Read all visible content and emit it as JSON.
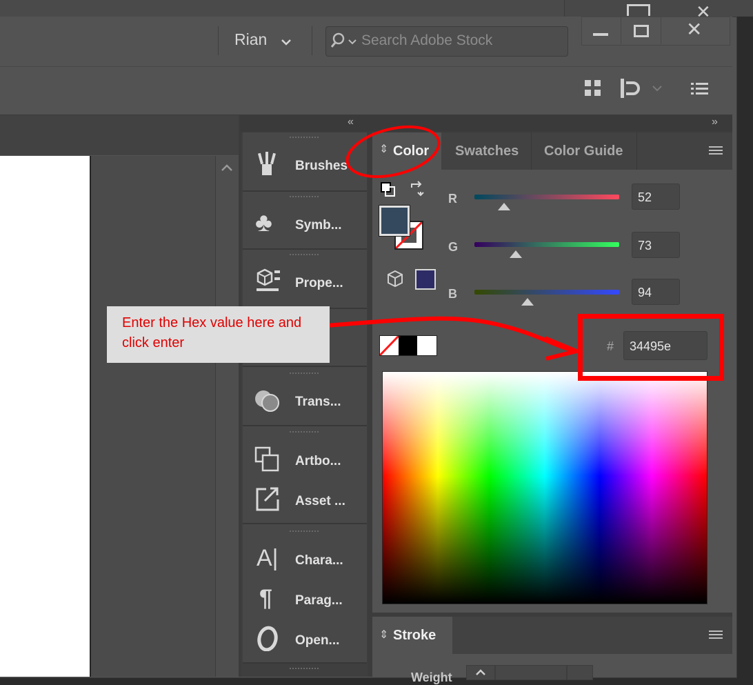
{
  "titlebar": {
    "user_name": "Rian",
    "search_placeholder": "Search Adobe Stock"
  },
  "panels": [
    {
      "label": "Brushes",
      "icon": "brushes-icon"
    },
    {
      "label": "Symb...",
      "icon": "club-symbol-icon"
    },
    {
      "label": "Prope...",
      "icon": "properties-icon"
    },
    {
      "label": "Trans...",
      "icon": "transparency-icon"
    },
    {
      "label": "Artbo...",
      "icon": "artboards-icon"
    },
    {
      "label": "Asset ...",
      "icon": "asset-export-icon"
    },
    {
      "label": "Chara...",
      "icon": "character-icon"
    },
    {
      "label": "Parag...",
      "icon": "paragraph-icon"
    },
    {
      "label": "Open...",
      "icon": "opentype-icon"
    }
  ],
  "color_panel": {
    "tabs": [
      "Color",
      "Swatches",
      "Color Guide"
    ],
    "active_tab": "Color",
    "channels": [
      {
        "label": "R",
        "value": "52"
      },
      {
        "label": "G",
        "value": "73"
      },
      {
        "label": "B",
        "value": "94"
      }
    ],
    "hex_symbol": "#",
    "hex_value": "34495e",
    "fill_color": "#34495e",
    "out_of_gamut_color": "#2e2c66"
  },
  "stroke_panel": {
    "tab": "Stroke",
    "weight_label": "Weight"
  },
  "annotation": {
    "callout_text": "Enter the Hex value here and click enter",
    "callout_color": "#e00000",
    "highlight_color": "#ff0000"
  }
}
